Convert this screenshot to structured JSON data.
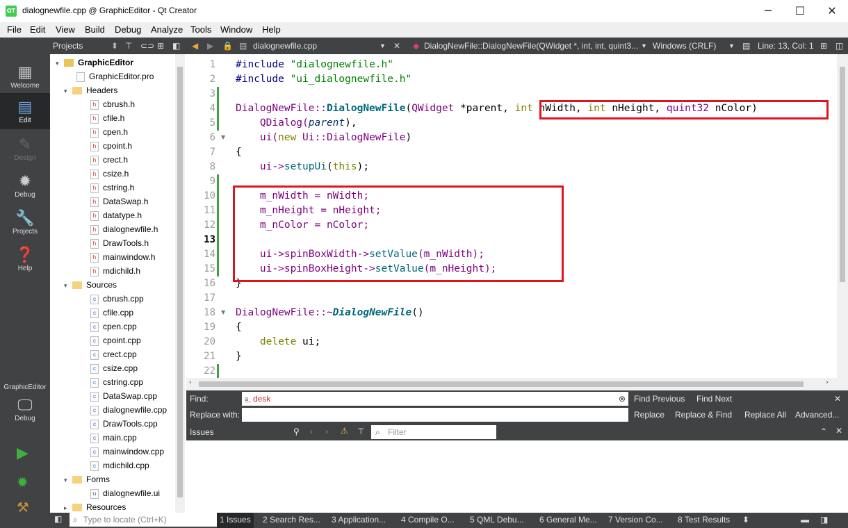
{
  "window": {
    "title": "dialognewfile.cpp @ GraphicEditor - Qt Creator",
    "app_icon": "QT",
    "minimize": "─",
    "maximize": "☐",
    "close": "✕"
  },
  "menu": [
    "File",
    "Edit",
    "View",
    "Build",
    "Debug",
    "Analyze",
    "Tools",
    "Window",
    "Help"
  ],
  "toolbar": {
    "panel_title": "Projects",
    "file_name": "dialognewfile.cpp",
    "symbol": "DialogNewFile::DialogNewFile(QWidget *, int, int, quint3...",
    "line_ending": "Windows (CRLF)",
    "position": "Line: 13, Col: 1"
  },
  "modes": [
    {
      "label": "Welcome",
      "icon": "grid-icon"
    },
    {
      "label": "Edit",
      "icon": "edit-icon"
    },
    {
      "label": "Design",
      "icon": "pencil-icon"
    },
    {
      "label": "Debug",
      "icon": "bug-icon"
    },
    {
      "label": "Projects",
      "icon": "wrench-icon"
    },
    {
      "label": "Help",
      "icon": "help-icon"
    }
  ],
  "kit": {
    "project": "GraphicEditor",
    "config": "Debug"
  },
  "tree": {
    "project": "GraphicEditor",
    "pro": "GraphicEditor.pro",
    "headers_label": "Headers",
    "headers": [
      "cbrush.h",
      "cfile.h",
      "cpen.h",
      "cpoint.h",
      "crect.h",
      "csize.h",
      "cstring.h",
      "DataSwap.h",
      "datatype.h",
      "dialognewfile.h",
      "DrawTools.h",
      "mainwindow.h",
      "mdichild.h"
    ],
    "sources_label": "Sources",
    "sources": [
      "cbrush.cpp",
      "cfile.cpp",
      "cpen.cpp",
      "cpoint.cpp",
      "crect.cpp",
      "csize.cpp",
      "cstring.cpp",
      "DataSwap.cpp",
      "dialognewfile.cpp",
      "DrawTools.cpp",
      "main.cpp",
      "mainwindow.cpp",
      "mdichild.cpp"
    ],
    "forms_label": "Forms",
    "forms": [
      "dialognewfile.ui"
    ],
    "resources_label": "Resources"
  },
  "code": {
    "line_numbers": [
      "1",
      "2",
      "3",
      "4",
      "5",
      "6",
      "7",
      "8",
      "9",
      "10",
      "11",
      "12",
      "13",
      "14",
      "15",
      "16",
      "17",
      "18",
      "19",
      "20",
      "21",
      "22"
    ],
    "l1a": "#include ",
    "l1b": "\"dialognewfile.h\"",
    "l2a": "#include ",
    "l2b": "\"ui_dialognewfile.h\"",
    "l4a": "DialogNewFile::",
    "l4b": "DialogNewFile",
    "l4c": "(",
    "l4d": "QWidget",
    " l4e": "",
    "l4f": " *parent, ",
    "l4g": "int",
    " l4h": "",
    "l4i": " nWidth, ",
    "l4j": "int",
    "l4k": " nHeight, ",
    "l4l": "quint32",
    "l4m": " nColor)",
    "l5a": "    QDialog(",
    "l5b": "parent",
    "l5c": "),",
    "l6a": "    ui(",
    "l6b": "new",
    "l6c": " Ui::",
    "l6d": "DialogNewFile",
    "l6e": ")",
    "l7": "{",
    "l8a": "    ui->",
    "l8b": "setupUi",
    "l8c": "(",
    "l8d": "this",
    "l8e": ");",
    "l10": "    m_nWidth = nWidth;",
    "l11": "    m_nHeight = nHeight;",
    "l12": "    m_nColor = nColor;",
    "l14a": "    ui->spinBoxWidth->",
    "l14b": "setValue",
    "l14c": "(m_nWidth);",
    "l15a": "    ui->spinBoxHeight->",
    "l15b": "setValue",
    "l15c": "(m_nHeight);",
    "l16": "}",
    "l18a": "DialogNewFile::~",
    "l18b": "DialogNewFile",
    "l18c": "()",
    "l19": "{",
    "l20a": "    ",
    "l20b": "delete",
    "l20c": " ui;",
    "l21": "}"
  },
  "find": {
    "find_label": "Find:",
    "find_value": "desk",
    "replace_label": "Replace with:",
    "find_previous": "Find Previous",
    "find_next": "Find Next",
    "replace": "Replace",
    "replace_find": "Replace & Find",
    "replace_all": "Replace All",
    "advanced": "Advanced..."
  },
  "issues": {
    "title": "Issues",
    "filter_placeholder": "Filter"
  },
  "status": {
    "locate_placeholder": "Type to locate (Ctrl+K)",
    "tabs": [
      "1  Issues",
      "2  Search Res...",
      "3  Application...",
      "4  Compile O...",
      "5  QML Debu...",
      "6  General Me...",
      "7  Version Co...",
      "8  Test Results"
    ]
  },
  "colors": {
    "highlight": "#e0141e",
    "dark_panel": "#404244",
    "keyword": "#808000",
    "string": "#008000",
    "type": "#800080",
    "function": "#00677c"
  }
}
